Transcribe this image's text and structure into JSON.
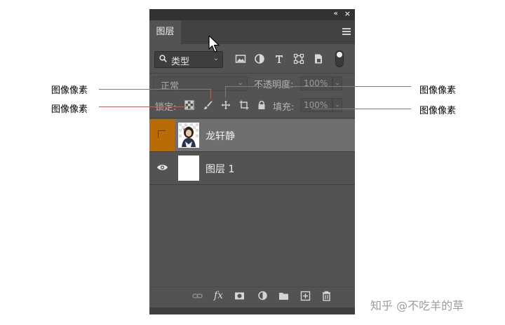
{
  "panel": {
    "topbar": {
      "collapse_icon": "«",
      "close_icon": "×"
    },
    "tab_label": "图层",
    "menu_icon": "hamburger-icon"
  },
  "filter": {
    "kind_label": "类型",
    "icons": [
      "image-filter-icon",
      "adjustment-filter-icon",
      "type-filter-icon",
      "shape-filter-icon",
      "smart-object-filter-icon",
      "filter-toggle"
    ]
  },
  "blend": {
    "mode_label": "正常",
    "opacity_label": "不透明度:",
    "opacity_value": "100%"
  },
  "lock": {
    "lock_label": "锁定:",
    "fill_label": "填充:",
    "fill_value": "100%"
  },
  "layers": [
    {
      "name": "龙轩静",
      "selected": true,
      "visible": false
    },
    {
      "name": "图层 1",
      "selected": false,
      "visible": true
    }
  ],
  "bottom_icons": [
    "link-layers-icon",
    "fx-icon",
    "layer-mask-icon",
    "adjustment-layer-icon",
    "group-folder-icon",
    "new-layer-icon",
    "trash-icon"
  ],
  "fx_label": "fx",
  "annotations": {
    "left_top": "图像像素",
    "left_bottom": "图像像素",
    "right_top": "图像像素",
    "right_bottom": "图像像素"
  },
  "watermark": "知乎 @不吃羊的草",
  "colors": {
    "panel_bg": "#535353",
    "selected_layer": "#6f6f6f",
    "orange_highlight": "#b76c08",
    "callout_line": "#b5655f"
  }
}
